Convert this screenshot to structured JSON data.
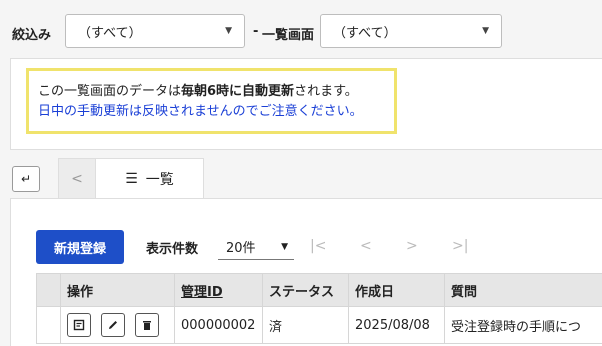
{
  "filters": {
    "narrow_label": "絞込み",
    "narrow_value": "（すべて）",
    "list_label": "一覧画面",
    "list_value": "（すべて）"
  },
  "notice": {
    "line1_pre": "この一覧画面のデータは",
    "line1_bold": "毎朝6時に自動更新",
    "line1_post": "されます。",
    "line2": "日中の手動更新は反映されませんのでご注意ください。",
    "border_color": "#f0e36c",
    "line2_color": "#1a3fd6"
  },
  "tabs": {
    "swap_icon": "swap-icon",
    "prev_glyph": "<",
    "active_label": "一覧"
  },
  "toolbar": {
    "new_label": "新規登録",
    "count_label": "表示件数",
    "count_value": "20件",
    "first": "|<",
    "prev": "<",
    "next": ">",
    "last": ">|"
  },
  "table": {
    "headers": [
      "操作",
      "管理ID",
      "ステータス",
      "作成日",
      "質問"
    ],
    "rows": [
      {
        "id": "000000002",
        "status": "済",
        "created": "2025/08/08",
        "question": "受注登録時の手順につ"
      }
    ]
  },
  "colors": {
    "accent": "#1e4fc8"
  }
}
